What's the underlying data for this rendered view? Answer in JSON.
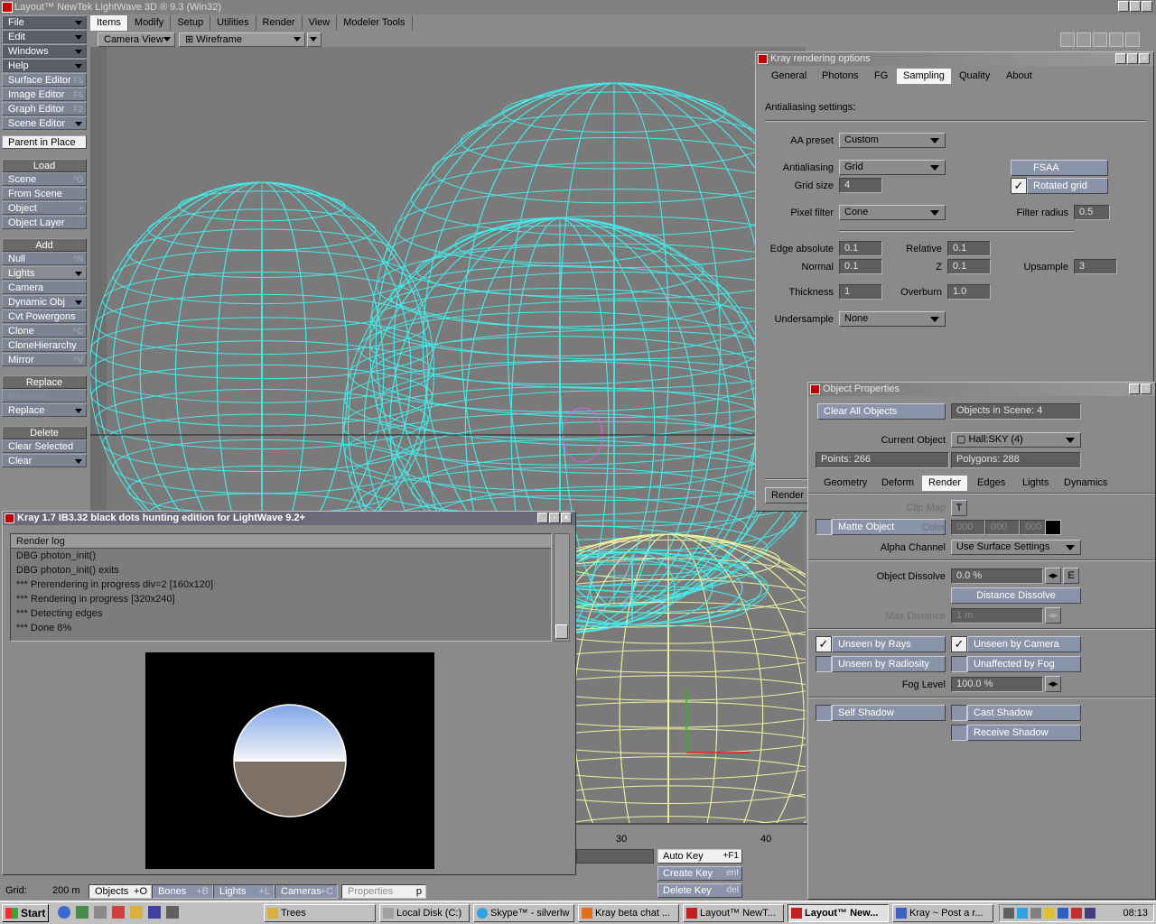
{
  "app": {
    "title": "Layout™ NewTek LightWave 3D ® 9.3 (Win32)"
  },
  "sidebar": {
    "menus": [
      {
        "label": "File"
      },
      {
        "label": "Edit"
      },
      {
        "label": "Windows"
      },
      {
        "label": "Help"
      }
    ],
    "editors": [
      {
        "label": "Surface Editor",
        "shortcut": "F5"
      },
      {
        "label": "Image Editor",
        "shortcut": "F6"
      },
      {
        "label": "Graph Editor",
        "shortcut": "F2"
      },
      {
        "label": "Scene Editor",
        "shortcut": ""
      }
    ],
    "parent_in_place": "Parent in Place",
    "load_header": "Load",
    "load_items": [
      {
        "label": "Scene",
        "shortcut": "^O"
      },
      {
        "label": "From Scene",
        "shortcut": ""
      },
      {
        "label": "Object",
        "shortcut": "+"
      },
      {
        "label": "Object Layer",
        "shortcut": ""
      }
    ],
    "add_header": "Add",
    "add_items": [
      {
        "label": "Null",
        "shortcut": "^N"
      },
      {
        "label": "Lights",
        "shortcut": ""
      },
      {
        "label": "Camera",
        "shortcut": ""
      },
      {
        "label": "Dynamic Obj",
        "shortcut": ""
      },
      {
        "label": "Cvt Powergons",
        "shortcut": ""
      },
      {
        "label": "Clone",
        "shortcut": "^C"
      },
      {
        "label": "CloneHierarchy",
        "shortcut": ""
      },
      {
        "label": "Mirror",
        "shortcut": "^V"
      }
    ],
    "replace_header": "Replace",
    "replace_items": [
      {
        "label": "Rename"
      },
      {
        "label": "Replace"
      }
    ],
    "delete_header": "Delete",
    "delete_items": [
      {
        "label": "Clear Selected"
      },
      {
        "label": "Clear"
      }
    ]
  },
  "toptabs": [
    "Items",
    "Modify",
    "Setup",
    "Utilities",
    "Render",
    "View",
    "Modeler Tools"
  ],
  "viewbar": {
    "view": "Camera View",
    "mode": "Wireframe"
  },
  "kray_options": {
    "title": "Kray rendering options",
    "tabs": [
      "General",
      "Photons",
      "FG",
      "Sampling",
      "Quality",
      "About"
    ],
    "active_tab": "Sampling",
    "section": "Antialiasing settings:",
    "aa_preset_label": "AA preset",
    "aa_preset": "Custom",
    "antialiasing_label": "Antialiasing",
    "antialiasing": "Grid",
    "grid_size_label": "Grid size",
    "grid_size": "4",
    "fsaa": "FSAA",
    "rotated_grid": "Rotated grid",
    "rotated_grid_checked": true,
    "pixel_filter_label": "Pixel filter",
    "pixel_filter": "Cone",
    "filter_radius_label": "Filter radius",
    "filter_radius": "0.5",
    "edge_absolute_label": "Edge absolute",
    "edge_absolute": "0.1",
    "relative_label": "Relative",
    "relative": "0.1",
    "normal_label": "Normal",
    "normal": "0.1",
    "z_label": "Z",
    "z": "0.1",
    "upsample_label": "Upsample",
    "upsample": "3",
    "thickness_label": "Thickness",
    "thickness": "1",
    "overburn_label": "Overburn",
    "overburn": "1.0",
    "undersample_label": "Undersample",
    "undersample": "None",
    "render_button": "Render"
  },
  "object_properties": {
    "title": "Object Properties",
    "clear_all": "Clear All Objects",
    "objects_in_scene": "Objects in Scene: 4",
    "current_object_label": "Current Object",
    "current_object": "Hall:SKY (4)",
    "points": "Points: 266",
    "polygons": "Polygons: 288",
    "tabs": [
      "Geometry",
      "Deform",
      "Render",
      "Edges",
      "Lights",
      "Dynamics"
    ],
    "active_tab": "Render",
    "clip_map_label": "Clip Map",
    "clip_map_btn": "T",
    "matte_object": "Matte Object",
    "color_label": "Color",
    "color_values": [
      "000",
      "000",
      "000"
    ],
    "alpha_channel_label": "Alpha Channel",
    "alpha_channel": "Use Surface Settings",
    "object_dissolve_label": "Object Dissolve",
    "object_dissolve": "0.0 %",
    "envelope_btn": "E",
    "distance_dissolve": "Distance Dissolve",
    "max_distance_label": "Max Distance",
    "max_distance": "1 m",
    "unseen_by_rays": "Unseen by Rays",
    "unseen_by_rays_checked": true,
    "unseen_by_camera": "Unseen by Camera",
    "unseen_by_camera_checked": true,
    "unseen_by_radiosity": "Unseen by Radiosity",
    "unaffected_by_fog": "Unaffected by Fog",
    "fog_level_label": "Fog Level",
    "fog_level": "100.0 %",
    "self_shadow": "Self Shadow",
    "cast_shadow": "Cast Shadow",
    "receive_shadow": "Receive Shadow"
  },
  "render_log": {
    "title": "Kray 1.7 IB3.32 black dots hunting edition for LightWave 9.2+",
    "header": "Render log",
    "lines": [
      "DBG photon_init()",
      "DBG photon_init() exits",
      "*** Prerendering in progress div=2 [160x120]",
      "*** Rendering in progress [320x240]",
      "*** Detecting edges",
      "*** Done 8%"
    ]
  },
  "timeline": {
    "ticks": [
      "30",
      "40"
    ]
  },
  "keys": [
    {
      "label": "Auto Key",
      "shortcut": "+F1"
    },
    {
      "label": "Create Key",
      "shortcut": "ent"
    },
    {
      "label": "Delete Key",
      "shortcut": "del"
    }
  ],
  "bottombar": {
    "grid_label": "Grid:",
    "grid_value": "200 m",
    "objects": "Objects",
    "objects_sc": "+O",
    "bones": "Bones",
    "bones_sc": "+B",
    "lights": "Lights",
    "lights_sc": "+L",
    "cameras": "Cameras",
    "cameras_sc": "+C",
    "properties": "Properties",
    "properties_sc": "p"
  },
  "taskbar": {
    "start": "Start",
    "tasks": [
      {
        "label": "Trees"
      },
      {
        "label": "Local Disk (C:)"
      },
      {
        "label": "Skype™ - silverlw"
      },
      {
        "label": "Kray beta chat ..."
      },
      {
        "label": "Layout™ NewT..."
      },
      {
        "label": "Layout™ New..."
      },
      {
        "label": "Kray ~ Post a r..."
      }
    ],
    "clock": "08:13"
  },
  "colors": {
    "wire_cyan": "#48e8e8",
    "wire_yellow": "#f0f0a0",
    "button_blue": "#8a94a8"
  }
}
